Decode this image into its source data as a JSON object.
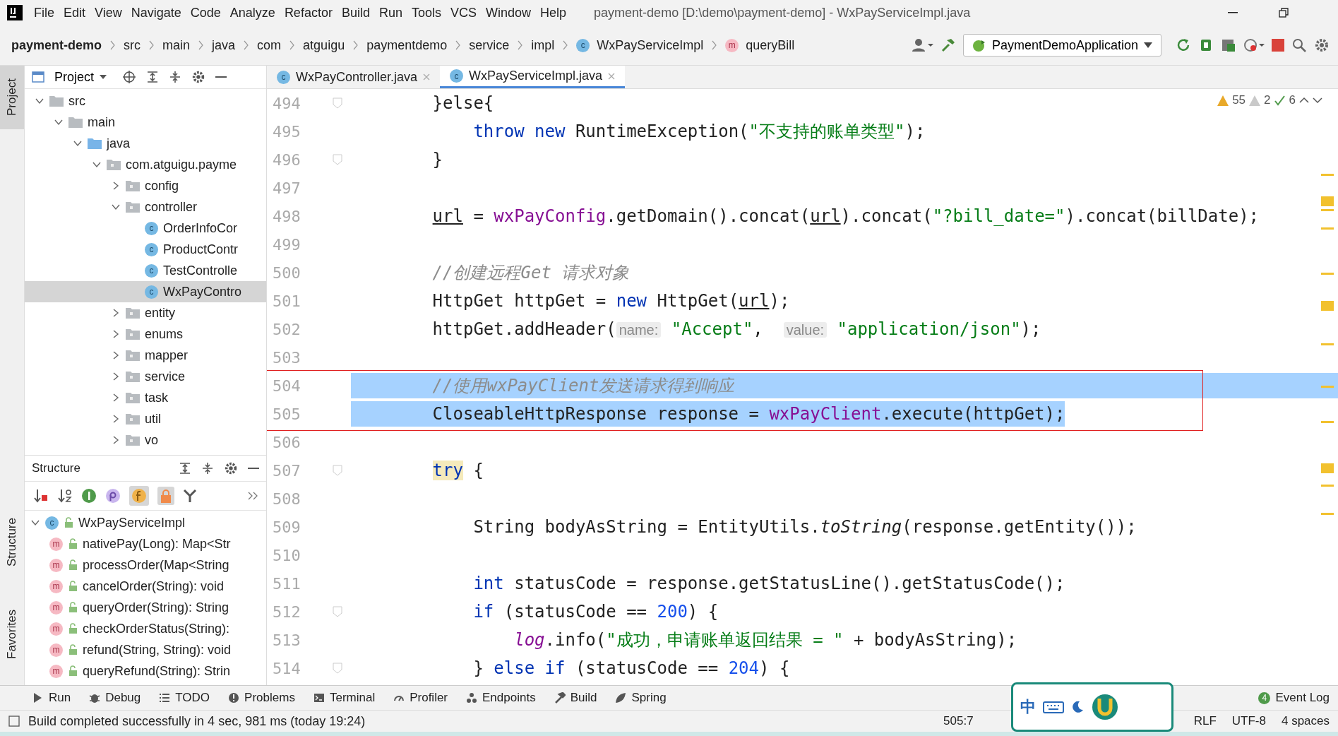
{
  "window": {
    "title": "payment-demo [D:\\demo\\payment-demo] - WxPayServiceImpl.java"
  },
  "menu": [
    "File",
    "Edit",
    "View",
    "Navigate",
    "Code",
    "Analyze",
    "Refactor",
    "Build",
    "Run",
    "Tools",
    "VCS",
    "Window",
    "Help"
  ],
  "breadcrumbs": [
    {
      "label": "payment-demo",
      "kind": "project"
    },
    {
      "label": "src",
      "kind": "plain"
    },
    {
      "label": "main",
      "kind": "plain"
    },
    {
      "label": "java",
      "kind": "plain"
    },
    {
      "label": "com",
      "kind": "plain"
    },
    {
      "label": "atguigu",
      "kind": "plain"
    },
    {
      "label": "paymentdemo",
      "kind": "plain"
    },
    {
      "label": "service",
      "kind": "plain"
    },
    {
      "label": "impl",
      "kind": "plain"
    },
    {
      "label": "WxPayServiceImpl",
      "kind": "class",
      "badge": "c"
    },
    {
      "label": "queryBill",
      "kind": "method",
      "badge": "m"
    }
  ],
  "run_configuration": "PaymentDemoApplication",
  "side_tabs": [
    {
      "label": "Project",
      "selected": true
    },
    {
      "label": "Structure",
      "selected": false
    },
    {
      "label": "Favorites",
      "selected": false
    }
  ],
  "project_panel": {
    "title": "Project",
    "tree": [
      {
        "label": "src",
        "kind": "folder",
        "expanded": true,
        "selected": false,
        "children": [
          {
            "label": "main",
            "kind": "folder",
            "expanded": true,
            "selected": false,
            "children": [
              {
                "label": "java",
                "kind": "source",
                "expanded": true,
                "selected": false,
                "children": [
                  {
                    "label": "com.atguigu.payme",
                    "kind": "package",
                    "expanded": true,
                    "selected": false,
                    "children": [
                      {
                        "label": "config",
                        "kind": "package",
                        "expanded": false,
                        "selected": false
                      },
                      {
                        "label": "controller",
                        "kind": "package",
                        "expanded": true,
                        "selected": false,
                        "children": [
                          {
                            "label": "OrderInfoCor",
                            "kind": "class",
                            "badge": "c",
                            "selected": false
                          },
                          {
                            "label": "ProductContr",
                            "kind": "class",
                            "badge": "c",
                            "selected": false
                          },
                          {
                            "label": "TestControlle",
                            "kind": "class",
                            "badge": "c",
                            "selected": false
                          },
                          {
                            "label": "WxPayContro",
                            "kind": "class",
                            "badge": "c",
                            "selected": true
                          }
                        ]
                      },
                      {
                        "label": "entity",
                        "kind": "package",
                        "expanded": false,
                        "selected": false
                      },
                      {
                        "label": "enums",
                        "kind": "package",
                        "expanded": false,
                        "selected": false
                      },
                      {
                        "label": "mapper",
                        "kind": "package",
                        "expanded": false,
                        "selected": false
                      },
                      {
                        "label": "service",
                        "kind": "package",
                        "expanded": false,
                        "selected": false
                      },
                      {
                        "label": "task",
                        "kind": "package",
                        "expanded": false,
                        "selected": false
                      },
                      {
                        "label": "util",
                        "kind": "package",
                        "expanded": false,
                        "selected": false
                      },
                      {
                        "label": "vo",
                        "kind": "package",
                        "expanded": false,
                        "selected": false
                      }
                    ]
                  }
                ]
              }
            ]
          }
        ]
      }
    ]
  },
  "structure_panel": {
    "title": "Structure",
    "tree": [
      {
        "label": "WxPayServiceImpl",
        "kind": "class",
        "badge": "c",
        "expanded": true,
        "children": [
          {
            "label": "nativePay(Long): Map<Str",
            "kind": "method",
            "badge": "m"
          },
          {
            "label": "processOrder(Map<String",
            "kind": "method",
            "badge": "m"
          },
          {
            "label": "cancelOrder(String): void",
            "kind": "method",
            "badge": "m"
          },
          {
            "label": "queryOrder(String): String",
            "kind": "method",
            "badge": "m"
          },
          {
            "label": "checkOrderStatus(String):",
            "kind": "method",
            "badge": "m"
          },
          {
            "label": "refund(String, String): void",
            "kind": "method",
            "badge": "m"
          },
          {
            "label": "queryRefund(String): Strin",
            "kind": "method",
            "badge": "m"
          }
        ]
      }
    ]
  },
  "editor": {
    "tabs": [
      {
        "label": "WxPayController.java",
        "badge": "c",
        "selected": false
      },
      {
        "label": "WxPayServiceImpl.java",
        "badge": "c",
        "selected": true
      }
    ],
    "inspections": {
      "warnings": "55",
      "weak_warnings": "2",
      "typos": "6"
    },
    "lines": [
      {
        "number": "494",
        "fold": true,
        "tokens": [
          {
            "kind": "plain",
            "text": "        }else{"
          }
        ]
      },
      {
        "number": "495",
        "tokens": [
          {
            "kind": "keyword",
            "text": "            throw"
          },
          {
            "kind": "keyword",
            "text": " new"
          },
          {
            "kind": "plain",
            "text": " RuntimeException("
          },
          {
            "kind": "string",
            "text": "\"不支持的账单类型\""
          },
          {
            "kind": "plain",
            "text": ");"
          }
        ]
      },
      {
        "number": "496",
        "fold": true,
        "tokens": [
          {
            "kind": "plain",
            "text": "        }"
          }
        ]
      },
      {
        "number": "497"
      },
      {
        "number": "498",
        "tokens": [
          {
            "kind": "underline",
            "text": "        url"
          },
          {
            "kind": "plain",
            "text": " = "
          },
          {
            "kind": "field",
            "text": "wxPayConfig"
          },
          {
            "kind": "plain",
            "text": ".getDomain().concat("
          },
          {
            "kind": "underline",
            "text": "url"
          },
          {
            "kind": "plain",
            "text": ").concat("
          },
          {
            "kind": "string",
            "text": "\"?bill_date=\""
          },
          {
            "kind": "plain",
            "text": ").concat(billDate);"
          }
        ]
      },
      {
        "number": "499"
      },
      {
        "number": "500",
        "tokens": [
          {
            "kind": "comment",
            "text": "        //创建远程Get 请求对象"
          }
        ]
      },
      {
        "number": "501",
        "tokens": [
          {
            "kind": "plain",
            "text": "        HttpGet httpGet = "
          },
          {
            "kind": "keyword",
            "text": "new"
          },
          {
            "kind": "plain",
            "text": " HttpGet("
          },
          {
            "kind": "underline",
            "text": "url"
          },
          {
            "kind": "plain",
            "text": ");"
          }
        ]
      },
      {
        "number": "502",
        "tokens": [
          {
            "kind": "plain",
            "text": "        httpGet.addHeader("
          },
          {
            "kind": "hint",
            "text": "name:"
          },
          {
            "kind": "string",
            "text": " \"Accept\""
          },
          {
            "kind": "plain",
            "text": ",  "
          },
          {
            "kind": "hint",
            "text": "value:"
          },
          {
            "kind": "string",
            "text": " \"application/json\""
          },
          {
            "kind": "plain",
            "text": ");"
          }
        ]
      },
      {
        "number": "503"
      },
      {
        "number": "504",
        "selected": true,
        "framed": true,
        "tokens": [
          {
            "kind": "comment",
            "text": "        //使用wxPayClient发送请求得到响应"
          }
        ]
      },
      {
        "number": "505",
        "selected": true,
        "framed": true,
        "tokens": [
          {
            "kind": "plain",
            "text": "        CloseableHttpResponse response = "
          },
          {
            "kind": "field",
            "text": "wxPayClient"
          },
          {
            "kind": "plain",
            "text": ".execute(httpGet);"
          }
        ]
      },
      {
        "number": "506"
      },
      {
        "number": "507",
        "fold": true,
        "tokens": [
          {
            "kind": "keyword-marked",
            "text": "        try"
          },
          {
            "kind": "plain",
            "text": " {"
          }
        ]
      },
      {
        "number": "508"
      },
      {
        "number": "509",
        "tokens": [
          {
            "kind": "plain",
            "text": "            String bodyAsString = EntityUtils."
          },
          {
            "kind": "italic",
            "text": "toString"
          },
          {
            "kind": "plain",
            "text": "(response.getEntity());"
          }
        ]
      },
      {
        "number": "510"
      },
      {
        "number": "511",
        "tokens": [
          {
            "kind": "keyword",
            "text": "            int"
          },
          {
            "kind": "plain",
            "text": " statusCode = response.getStatusLine().getStatusCode();"
          }
        ]
      },
      {
        "number": "512",
        "fold": true,
        "tokens": [
          {
            "kind": "keyword",
            "text": "            if"
          },
          {
            "kind": "plain",
            "text": " (statusCode == "
          },
          {
            "kind": "number",
            "text": "200"
          },
          {
            "kind": "plain",
            "text": ") {"
          }
        ]
      },
      {
        "number": "513",
        "tokens": [
          {
            "kind": "static-field",
            "text": "                log"
          },
          {
            "kind": "plain",
            "text": ".info("
          },
          {
            "kind": "string",
            "text": "\"成功，申请账单返回结果 = \""
          },
          {
            "kind": "plain",
            "text": " + bodyAsString);"
          }
        ]
      },
      {
        "number": "514",
        "fold": true,
        "tokens": [
          {
            "kind": "plain",
            "text": "            } "
          },
          {
            "kind": "keyword",
            "text": "else if"
          },
          {
            "kind": "plain",
            "text": " (statusCode == "
          },
          {
            "kind": "number",
            "text": "204"
          },
          {
            "kind": "plain",
            "text": ") {"
          }
        ]
      }
    ]
  },
  "tool_windows": [
    {
      "label": "Run",
      "kind": "run"
    },
    {
      "label": "Debug",
      "kind": "bug"
    },
    {
      "label": "TODO",
      "kind": "list"
    },
    {
      "label": "Problems",
      "kind": "alert"
    },
    {
      "label": "Terminal",
      "kind": "terminal"
    },
    {
      "label": "Profiler",
      "kind": "gauge"
    },
    {
      "label": "Endpoints",
      "kind": "nodes"
    },
    {
      "label": "Build",
      "kind": "hammer"
    },
    {
      "label": "Spring",
      "kind": "leaf"
    }
  ],
  "event_log": {
    "label": "Event Log",
    "badge": "4"
  },
  "status_bar": {
    "message": "Build completed successfully in 4 sec, 981 ms (today 19:24)",
    "position": "505:7",
    "line_separator": "RLF",
    "encoding": "UTF-8",
    "indent": "4 spaces"
  },
  "input_method": {
    "label": "中"
  }
}
